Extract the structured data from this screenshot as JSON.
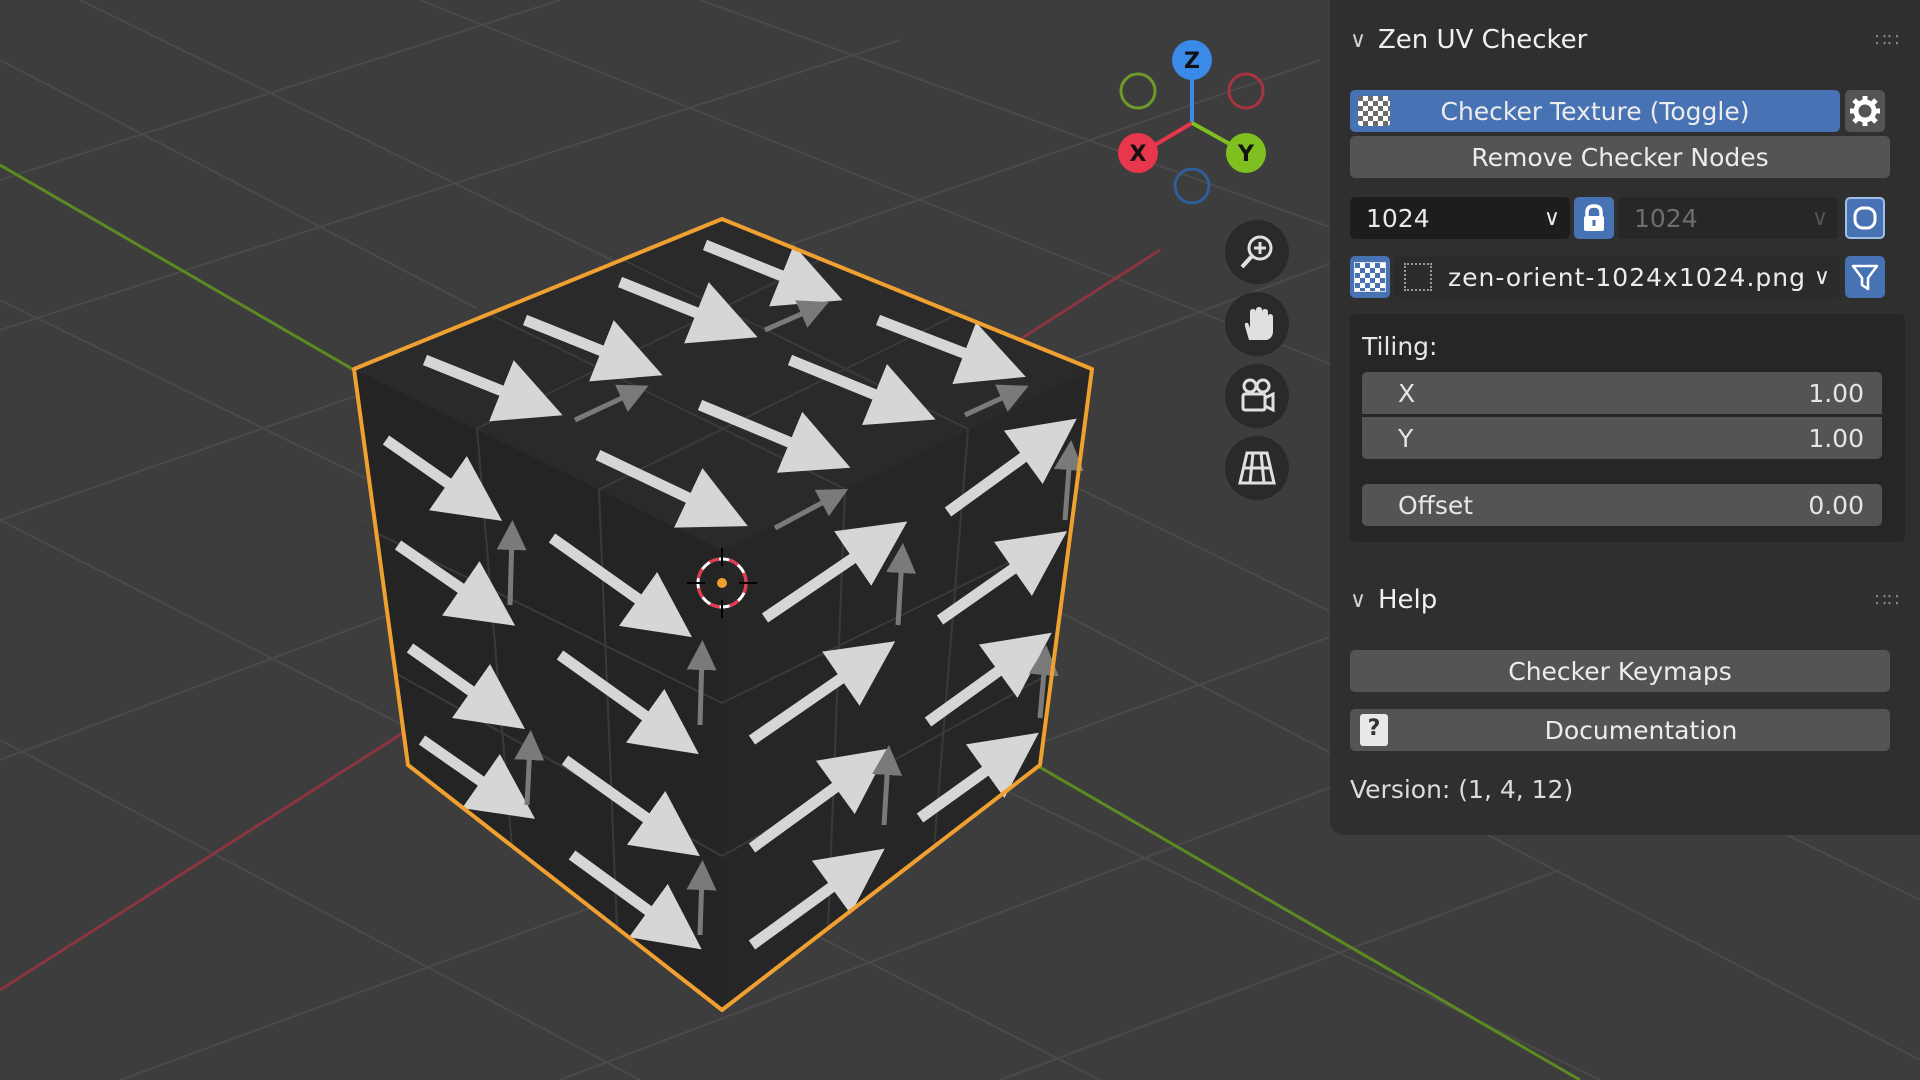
{
  "gizmo": {
    "z_label": "Z",
    "x_label": "X",
    "y_label": "Y"
  },
  "nav_icons": [
    "zoom-icon",
    "hand-pan-icon",
    "camera-icon",
    "grid-perspective-icon"
  ],
  "panel": {
    "title": "Zen UV Checker",
    "checker_toggle_label": "Checker Texture (Toggle)",
    "remove_nodes_label": "Remove Checker Nodes",
    "resolution_x": "1024",
    "resolution_y": "1024",
    "texture_name": "zen-orient-1024x1024.png",
    "tiling_label": "Tiling:",
    "tiling_x_label": "X",
    "tiling_x_value": "1.00",
    "tiling_y_label": "Y",
    "tiling_y_value": "1.00",
    "offset_label": "Offset",
    "offset_value": "0.00"
  },
  "help": {
    "title": "Help",
    "keymaps_label": "Checker Keymaps",
    "documentation_label": "Documentation",
    "version": "Version: (1, 4, 12)"
  },
  "colors": {
    "accent_blue": "#4772b3",
    "selection_orange": "#f0a030",
    "axis_x_red": "#e8364d",
    "axis_y_green": "#7fbf1f",
    "axis_z_blue": "#3a8ae8"
  }
}
